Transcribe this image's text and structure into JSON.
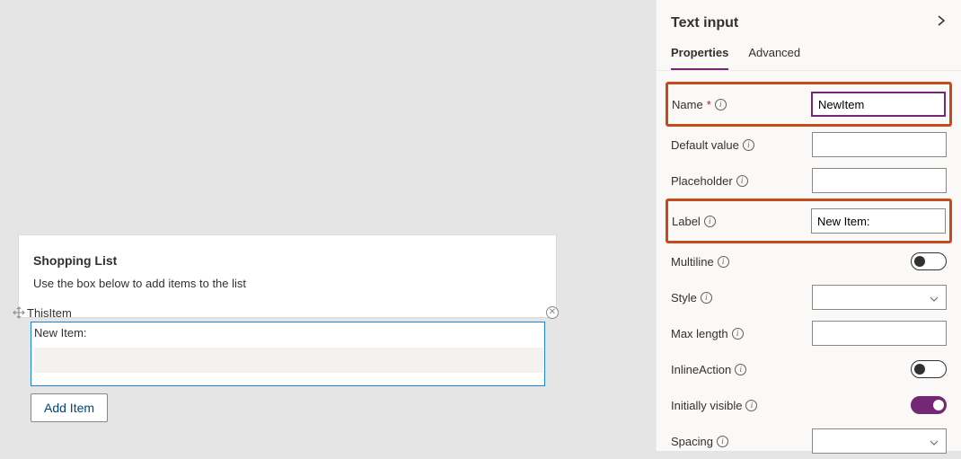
{
  "canvas": {
    "card_title": "Shopping List",
    "card_subtitle": "Use the box below to add items to the list",
    "thisitem_label": "ThisItem",
    "field_label": "New Item:",
    "field_value": "",
    "add_button": "Add Item"
  },
  "panel": {
    "title": "Text input",
    "tabs": {
      "properties": "Properties",
      "advanced": "Advanced"
    },
    "rows": {
      "name": {
        "label": "Name",
        "required": "*",
        "value": "NewItem"
      },
      "default_value": {
        "label": "Default value",
        "value": ""
      },
      "placeholder": {
        "label": "Placeholder",
        "value": ""
      },
      "label": {
        "label": "Label",
        "value": "New Item:"
      },
      "multiline": {
        "label": "Multiline"
      },
      "style": {
        "label": "Style"
      },
      "max_length": {
        "label": "Max length",
        "value": ""
      },
      "inline_action": {
        "label": "InlineAction"
      },
      "initially_visible": {
        "label": "Initially visible"
      },
      "spacing": {
        "label": "Spacing"
      }
    }
  }
}
